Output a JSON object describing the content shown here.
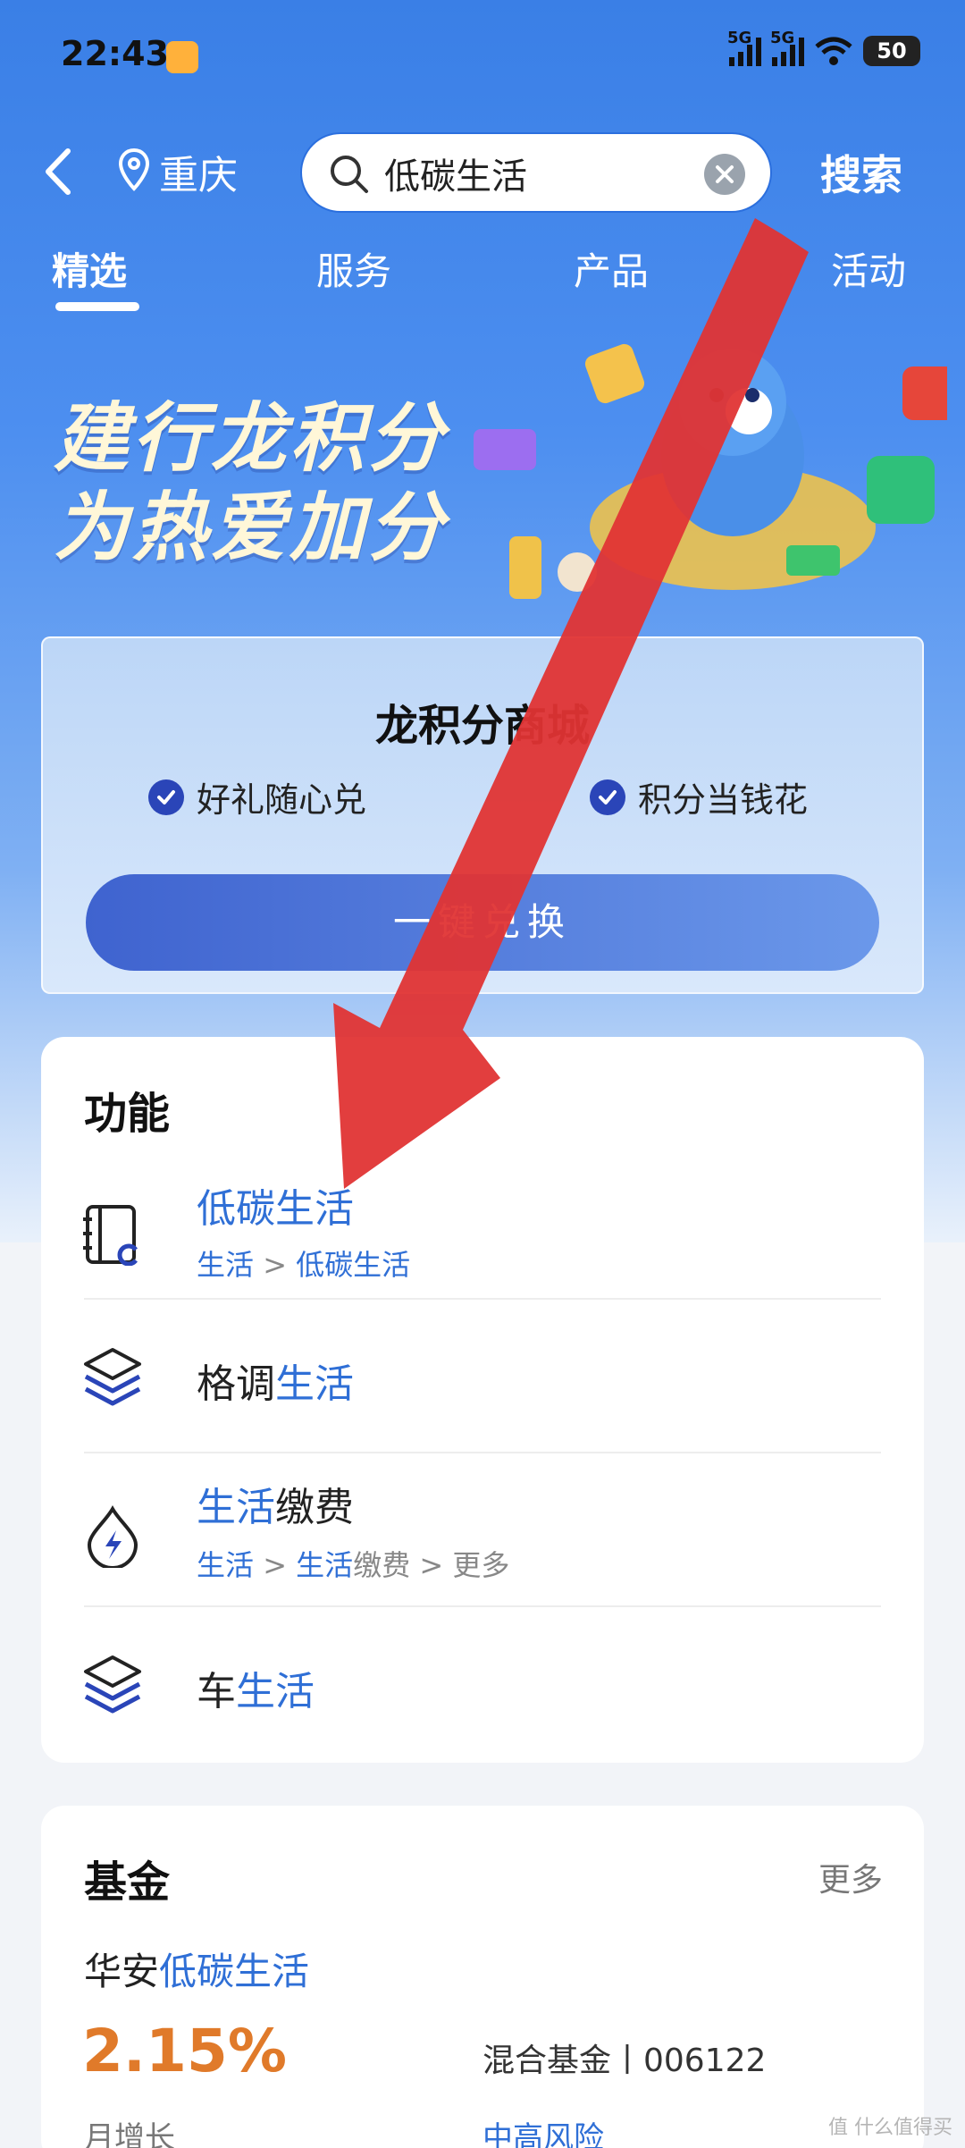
{
  "status_bar": {
    "time": "22:43",
    "network_1": "5G",
    "network_2": "5G",
    "battery": "50"
  },
  "search": {
    "city": "重庆",
    "query": "低碳生活",
    "button": "搜索"
  },
  "tabs": [
    {
      "label": "精选",
      "active": true
    },
    {
      "label": "服务",
      "active": false
    },
    {
      "label": "产品",
      "active": false
    },
    {
      "label": "活动",
      "active": false
    }
  ],
  "banner": {
    "line1": "建行龙积分",
    "line2": "为热爱加分"
  },
  "points_card": {
    "title": "龙积分商城",
    "feature_1": "好礼随心兑",
    "feature_2": "积分当钱花",
    "button": "一键兑换"
  },
  "functions": {
    "heading": "功能",
    "items": [
      {
        "name_pre": "",
        "name_hl": "低碳生活",
        "name_post": "",
        "path_a": "生活",
        "sep1": " > ",
        "path_b": "低碳生活",
        "icon": "ledger-c-icon"
      },
      {
        "name_pre": "格调",
        "name_hl": "生活",
        "name_post": "",
        "icon": "layers-icon"
      },
      {
        "name_pre": "",
        "name_hl": "生活",
        "name_post": "缴费",
        "path_a": "生活",
        "sep1": " > ",
        "path_b_hl": "生活",
        "path_b_rest": "缴费",
        "sep2": " > ",
        "path_c": "更多",
        "icon": "water-bolt-icon"
      },
      {
        "name_pre": "车",
        "name_hl": "生活",
        "name_post": "",
        "icon": "layers-icon"
      }
    ]
  },
  "fund": {
    "heading": "基金",
    "more": "更多",
    "name_pre": "华安",
    "name_hl": "低碳生活",
    "rate": "2.15%",
    "rate_label": "月增长",
    "type": "混合基金丨006122",
    "risk": "中高风险"
  },
  "watermark": "值 什么值得买",
  "colors": {
    "accent": "#2f6fd6",
    "rate": "#e07a2a",
    "annotation_arrow": "#e03434",
    "header_blue": "#3a7fe6"
  }
}
